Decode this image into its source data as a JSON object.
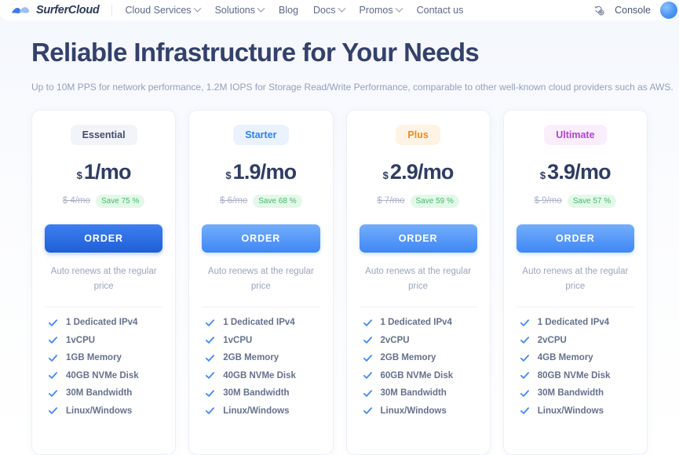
{
  "nav": {
    "brand": "SurferCloud",
    "logo_icon": "surfer-wave-logo",
    "links": [
      {
        "label": "Cloud Services",
        "has_dropdown": true
      },
      {
        "label": "Solutions",
        "has_dropdown": true
      },
      {
        "label": "Blog",
        "has_dropdown": false
      },
      {
        "label": "Docs",
        "has_dropdown": true
      },
      {
        "label": "Promos",
        "has_dropdown": true
      },
      {
        "label": "Contact us",
        "has_dropdown": false
      }
    ],
    "language_icon": "globe-translate-icon",
    "console_label": "Console",
    "avatar_icon": "user-avatar"
  },
  "hero": {
    "title": "Reliable Infrastructure for Your Needs",
    "subtitle": "Up to 10M PPS for network performance, 1.2M IOPS for Storage Read/Write Performance, comparable to other well-known cloud providers such as AWS."
  },
  "order_label": "ORDER",
  "renew_note": "Auto renews at the regular price",
  "colors": {
    "heading": "#33416b",
    "accent_blue": "#3f87f5",
    "active_blue": "#1f5fd6",
    "save_green": "#43b968",
    "badge_starter": "#2f7ff0",
    "badge_plus": "#f08a1d",
    "badge_ultimate": "#b341d8"
  },
  "plans": [
    {
      "badge": "Essential",
      "currency": "$",
      "price": "1/mo",
      "old_price": "$ 4/mo",
      "save": "Save 75 %",
      "button_active": true,
      "features": [
        "1 Dedicated IPv4",
        "1vCPU",
        "1GB Memory",
        "40GB NVMe Disk",
        "30M Bandwidth",
        "Linux/Windows"
      ]
    },
    {
      "badge": "Starter",
      "currency": "$",
      "price": "1.9/mo",
      "old_price": "$ 6/mo",
      "save": "Save 68 %",
      "button_active": false,
      "features": [
        "1 Dedicated IPv4",
        "1vCPU",
        "2GB Memory",
        "40GB NVMe Disk",
        "30M Bandwidth",
        "Linux/Windows"
      ]
    },
    {
      "badge": "Plus",
      "currency": "$",
      "price": "2.9/mo",
      "old_price": "$ 7/mo",
      "save": "Save 59 %",
      "button_active": false,
      "features": [
        "1 Dedicated IPv4",
        "2vCPU",
        "2GB Memory",
        "60GB NVMe Disk",
        "30M Bandwidth",
        "Linux/Windows"
      ]
    },
    {
      "badge": "Ultimate",
      "currency": "$",
      "price": "3.9/mo",
      "old_price": "$ 9/mo",
      "save": "Save 57 %",
      "button_active": false,
      "features": [
        "1 Dedicated IPv4",
        "2vCPU",
        "4GB Memory",
        "80GB NVMe Disk",
        "30M Bandwidth",
        "Linux/Windows"
      ]
    }
  ]
}
